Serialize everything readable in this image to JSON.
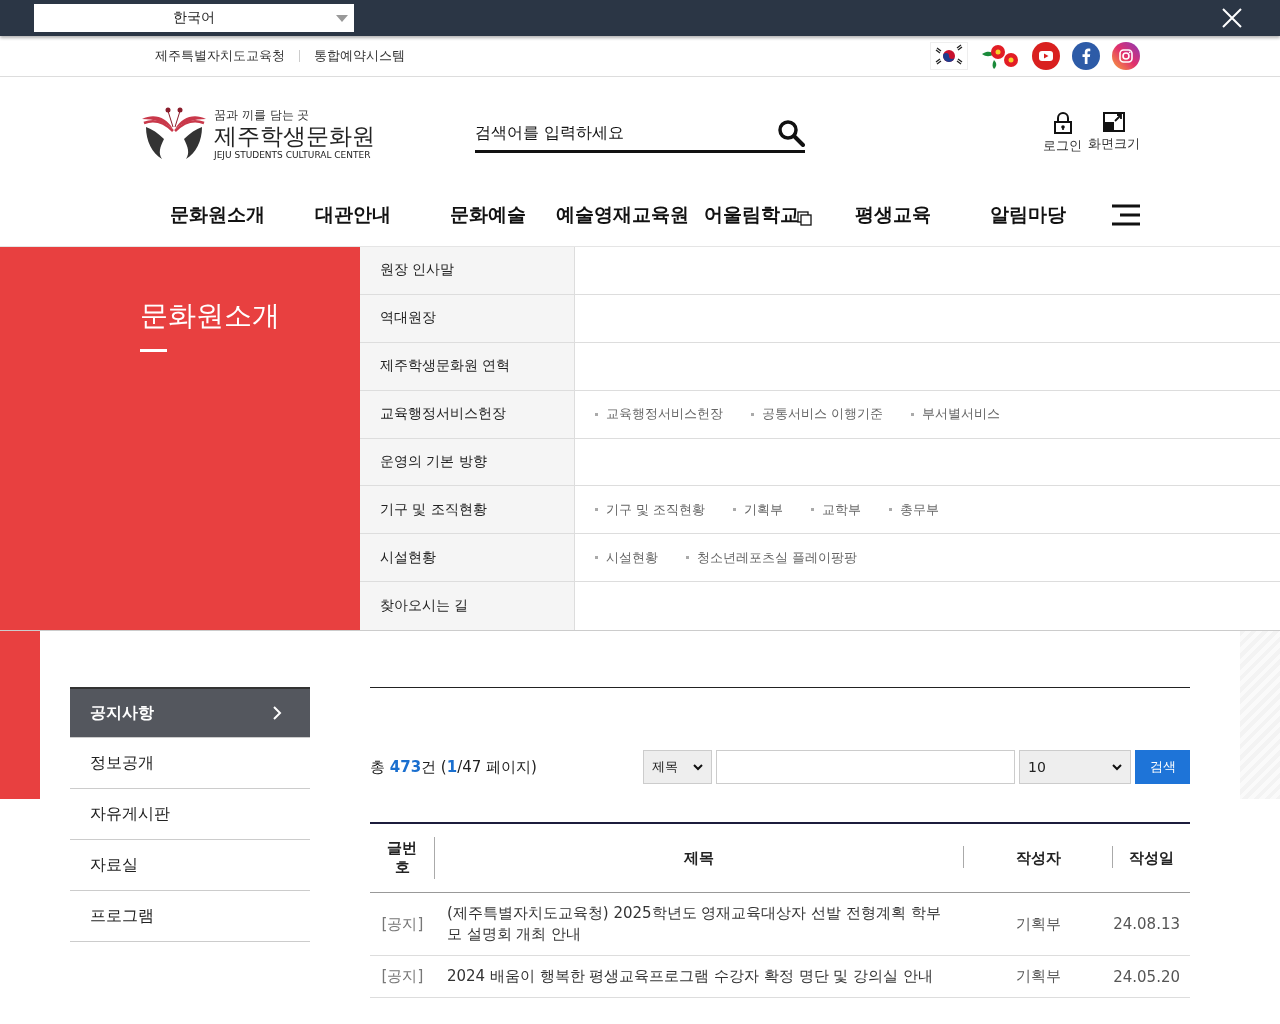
{
  "top_bar": {
    "language": "한국어"
  },
  "utility_links": [
    "제주특별자치도교육청",
    "통합예약시스템"
  ],
  "logo": {
    "tagline": "꿈과 끼를 담는 곳",
    "name": "제주학생문화원",
    "english": "JEJU STUDENTS CULTURAL CENTER"
  },
  "search": {
    "placeholder": "검색어를 입력하세요"
  },
  "header_actions": [
    {
      "label": "로그인",
      "kind": "login"
    },
    {
      "label": "화면크기",
      "kind": "zoom"
    }
  ],
  "nav": [
    {
      "label": "문화원소개",
      "external": false
    },
    {
      "label": "대관안내",
      "external": false
    },
    {
      "label": "문화예술",
      "external": false
    },
    {
      "label": "예술영재교육원",
      "external": false
    },
    {
      "label": "어울림학교",
      "external": true
    },
    {
      "label": "평생교육",
      "external": false
    },
    {
      "label": "알림마당",
      "external": false
    }
  ],
  "mega_menu": {
    "title": "문화원소개",
    "items": [
      {
        "label": "원장 인사말"
      },
      {
        "label": "역대원장"
      },
      {
        "label": "제주학생문화원 연혁"
      },
      {
        "label": "교육행정서비스헌장",
        "children": [
          "교육행정서비스헌장",
          "공통서비스 이행기준",
          "부서별서비스"
        ]
      },
      {
        "label": "운영의 기본 방향"
      },
      {
        "label": "기구 및 조직현황",
        "children": [
          "기구 및 조직현황",
          "기획부",
          "교학부",
          "총무부"
        ]
      },
      {
        "label": "시설현황",
        "children": [
          "시설현황",
          "청소년레포츠실 플레이팡팡"
        ]
      },
      {
        "label": "찾아오시는 길"
      }
    ]
  },
  "sidebar": {
    "items": [
      {
        "label": "공지사항",
        "selected": true
      },
      {
        "label": "정보공개",
        "selected": false
      },
      {
        "label": "자유게시판",
        "selected": false
      },
      {
        "label": "자료실",
        "selected": false
      },
      {
        "label": "프로그램",
        "selected": false
      }
    ]
  },
  "board": {
    "summary": [
      {
        "text": "총 ",
        "highlight": false
      },
      {
        "text": "473",
        "highlight": true
      },
      {
        "text": "건 (",
        "highlight": false
      },
      {
        "text": "1",
        "highlight": true
      },
      {
        "text": "/47 페이지)",
        "highlight": false
      }
    ],
    "filter_field": "제목",
    "page_size": "10",
    "search_button": "검색",
    "columns": [
      "글번호",
      "제목",
      "작성자",
      "작성일"
    ],
    "rows": [
      {
        "tag": "[공지]",
        "title": "(제주특별자치도교육청) 2025학년도 영재교육대상자 선발 전형계획 학부모 설명회 개최 안내",
        "author": "기획부",
        "date": "24.08.13"
      },
      {
        "tag": "[공지]",
        "title": "2024 배움이 행복한 평생교육프로그램 수강자 확정 명단 및 강의실 안내",
        "author": "기획부",
        "date": "24.05.20"
      }
    ]
  }
}
